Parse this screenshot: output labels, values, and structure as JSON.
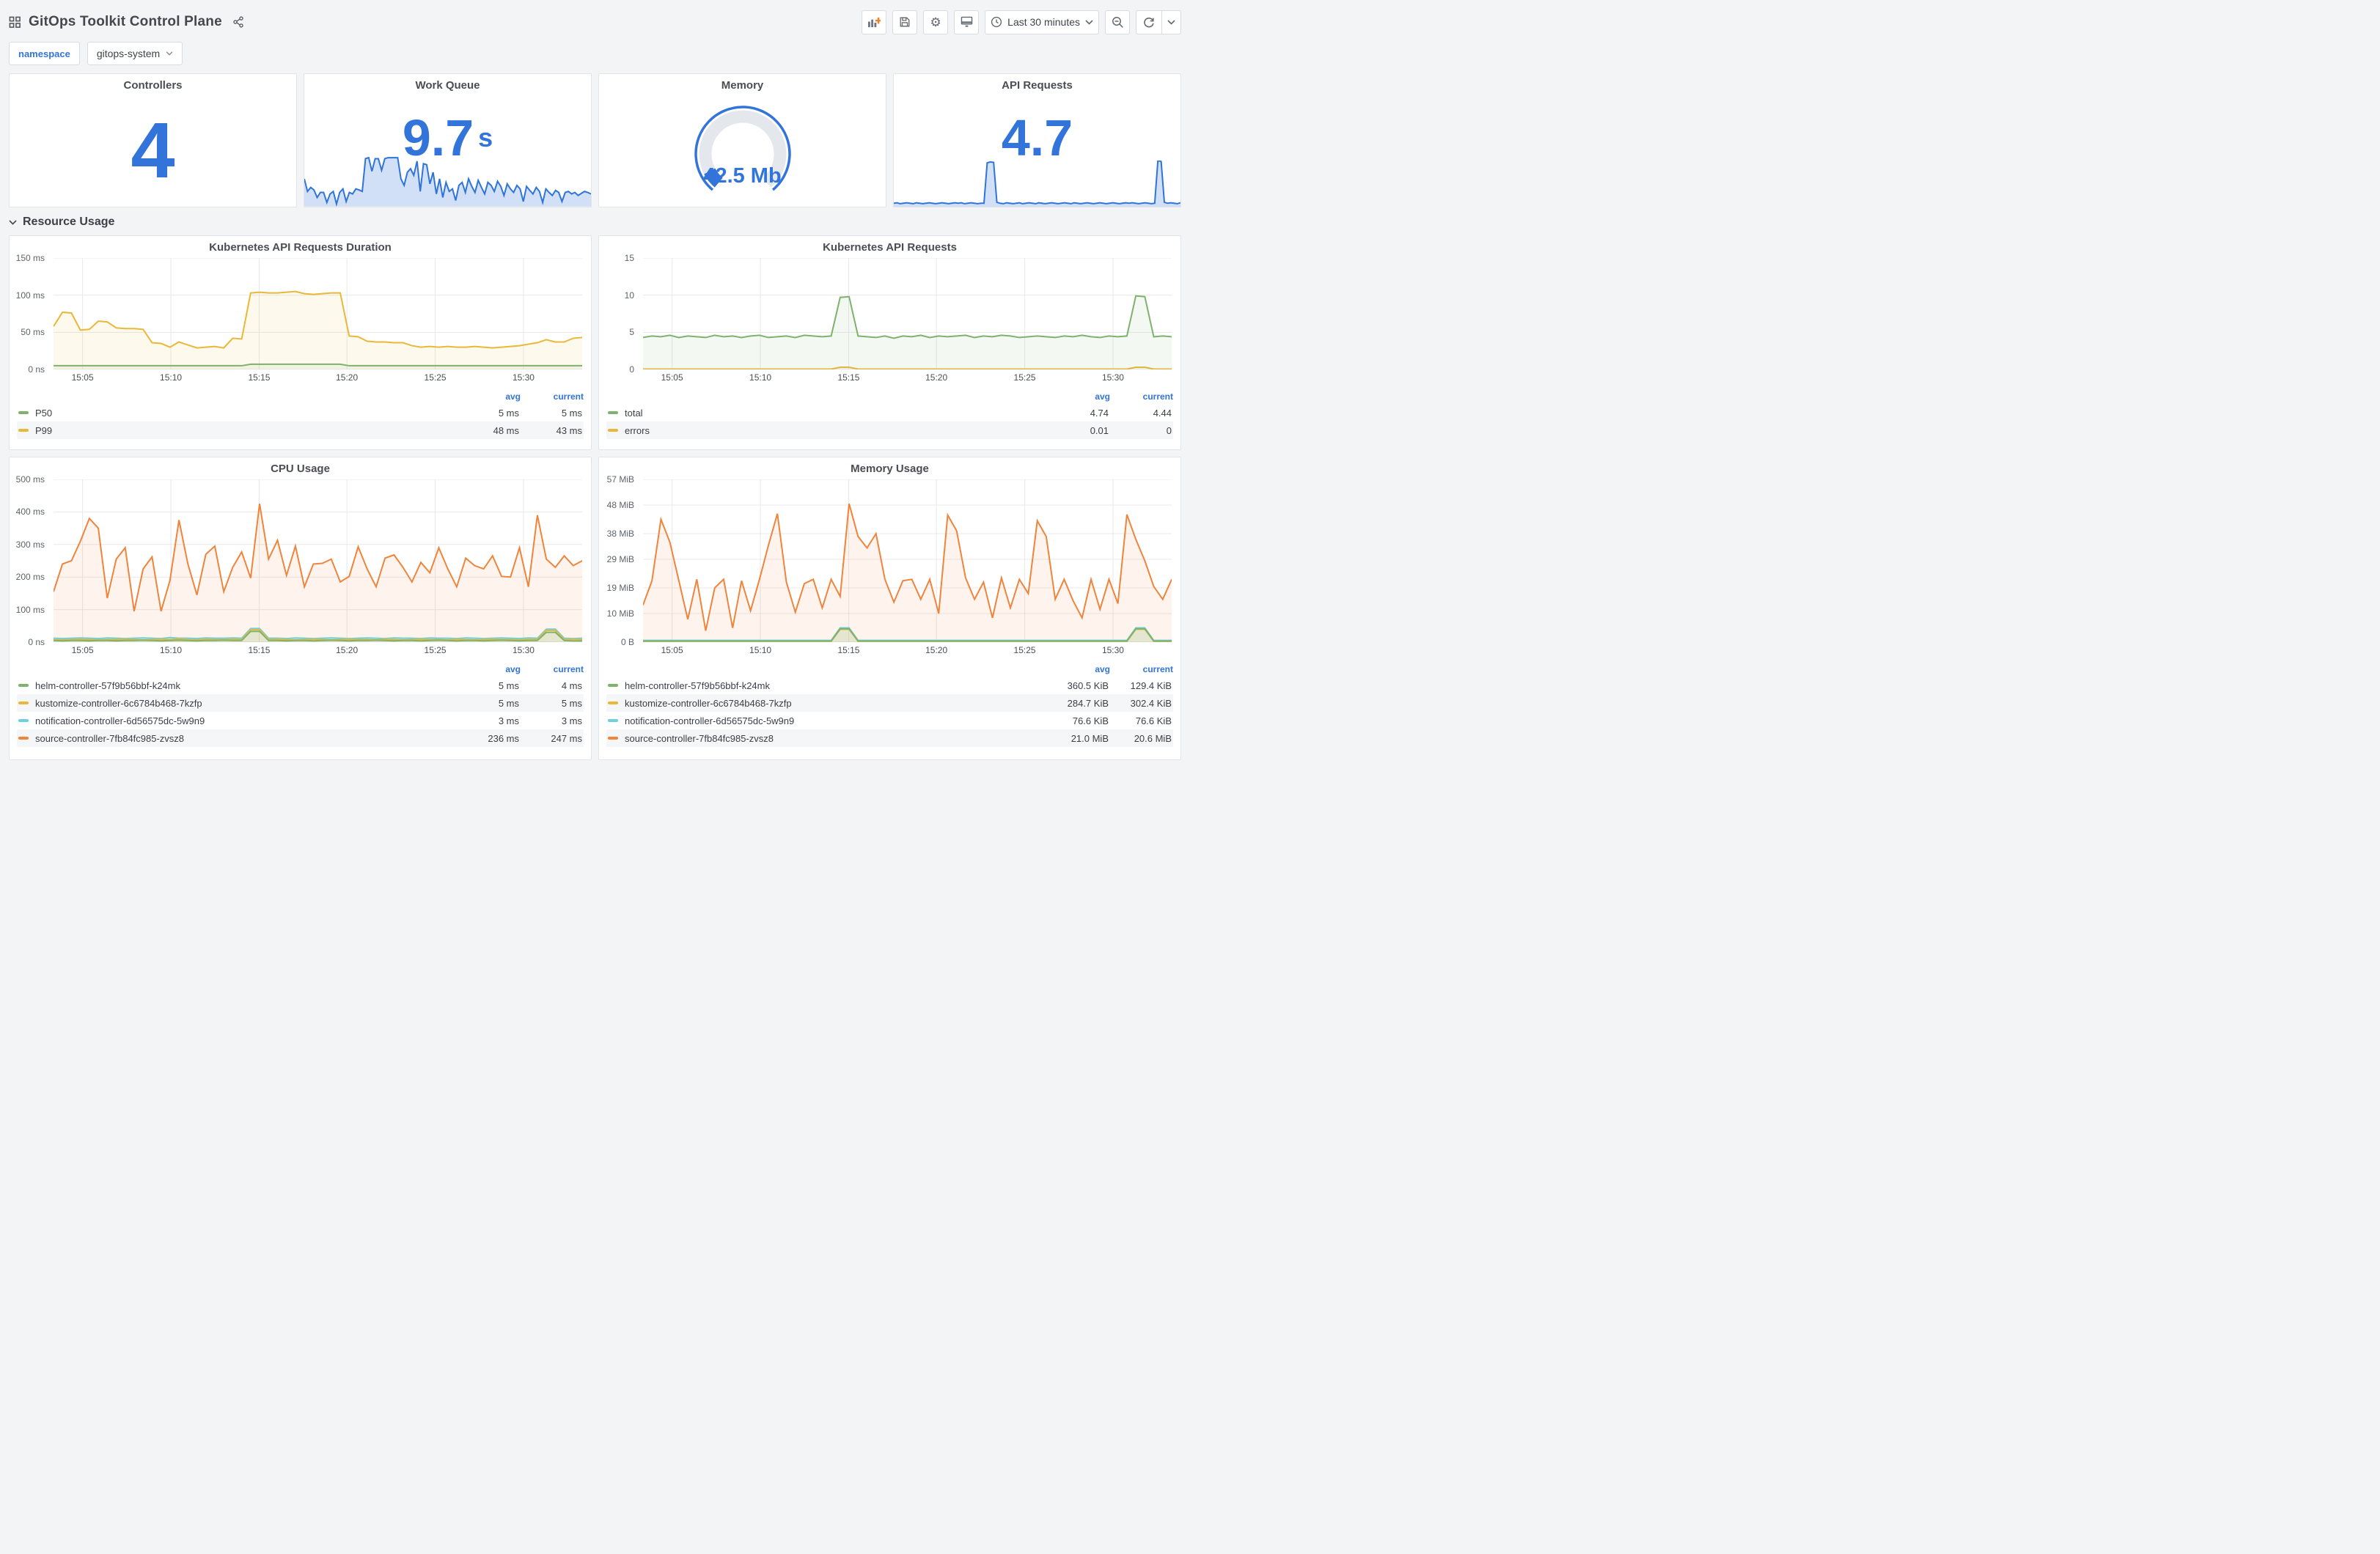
{
  "header": {
    "title": "GitOps Toolkit Control Plane",
    "time_range": "Last 30 minutes"
  },
  "variables": {
    "label": "namespace",
    "value": "gitops-system"
  },
  "row_title": "Resource Usage",
  "legend_headers": [
    "avg",
    "current"
  ],
  "colors": {
    "accent": "#3274D9",
    "green": "#7EB26D",
    "yellow": "#EAB839",
    "lightblue": "#6ED0E0",
    "orange": "#EF843C",
    "spark_line": "#2F74D9",
    "spark_fill": "rgba(50,116,217,0.22)"
  },
  "stats": {
    "controllers": {
      "title": "Controllers",
      "value": "4"
    },
    "work_queue": {
      "title": "Work Queue",
      "value": "9.7",
      "unit": "s",
      "spark": [
        55,
        30,
        38,
        33,
        18,
        28,
        28,
        8,
        25,
        30,
        5,
        28,
        35,
        10,
        28,
        25,
        35,
        33,
        30,
        95,
        97,
        70,
        95,
        95,
        72,
        95,
        97,
        97,
        97,
        97,
        55,
        42,
        68,
        75,
        62,
        90,
        30,
        85,
        83,
        45,
        68,
        25,
        55,
        18,
        48,
        30,
        35,
        12,
        42,
        48,
        28,
        55,
        40,
        28,
        52,
        38,
        25,
        48,
        42,
        30,
        50,
        40,
        22,
        45,
        35,
        28,
        42,
        35,
        10,
        40,
        32,
        25,
        38,
        30,
        8,
        35,
        28,
        22,
        32,
        28,
        10,
        28,
        30,
        25,
        28,
        22,
        26,
        30,
        28,
        25
      ]
    },
    "memory": {
      "title": "Memory",
      "value": "42.5 Mb",
      "fraction": 0.08
    },
    "api_requests": {
      "title": "API Requests",
      "value": "4.7",
      "spark": [
        8,
        9,
        7,
        8,
        9,
        8,
        7,
        9,
        8,
        7,
        8,
        9,
        8,
        7,
        8,
        9,
        8,
        7,
        8,
        9,
        8,
        9,
        7,
        8,
        9,
        8,
        7,
        8,
        8,
        95,
        97,
        96,
        10,
        8,
        7,
        9,
        8,
        7,
        8,
        9,
        7,
        8,
        9,
        8,
        7,
        9,
        8,
        7,
        8,
        9,
        8,
        7,
        8,
        9,
        8,
        7,
        9,
        8,
        7,
        8,
        9,
        8,
        7,
        8,
        9,
        8,
        7,
        8,
        9,
        8,
        7,
        8,
        9,
        8,
        9,
        8,
        7,
        8,
        9,
        8,
        7,
        8,
        100,
        98,
        10,
        8,
        9,
        8,
        7,
        9
      ]
    }
  },
  "x_ticks": [
    {
      "label": "15:05",
      "pos": 0.055
    },
    {
      "label": "15:10",
      "pos": 0.222
    },
    {
      "label": "15:15",
      "pos": 0.389
    },
    {
      "label": "15:20",
      "pos": 0.555
    },
    {
      "label": "15:25",
      "pos": 0.722
    },
    {
      "label": "15:30",
      "pos": 0.889
    }
  ],
  "charts": [
    {
      "title": "Kubernetes API Requests Duration",
      "type": "line",
      "ymax": 150,
      "y_ticks": [
        {
          "v": 0,
          "label": "0 ns"
        },
        {
          "v": 50,
          "label": "50 ms"
        },
        {
          "v": 100,
          "label": "100 ms"
        },
        {
          "v": 150,
          "label": "150 ms"
        }
      ],
      "series": [
        {
          "name": "P50",
          "color": "#7EB26D",
          "avg": "5 ms",
          "current": "5 ms",
          "values": [
            5,
            5,
            5,
            5,
            5,
            5,
            5,
            5,
            5,
            5,
            5,
            5,
            5,
            5,
            5,
            5,
            5,
            5,
            5,
            5,
            5,
            5,
            7,
            7,
            7,
            7,
            7,
            7,
            7,
            7,
            7,
            7,
            7,
            5,
            5,
            5,
            5,
            5,
            5,
            5,
            5,
            5,
            5,
            5,
            5,
            5,
            5,
            5,
            5,
            5,
            5,
            5,
            5,
            5,
            5,
            5,
            5,
            5,
            5,
            5
          ]
        },
        {
          "name": "P99",
          "color": "#EAB839",
          "avg": "48 ms",
          "current": "43 ms",
          "values": [
            58,
            77,
            76,
            53,
            54,
            65,
            64,
            56,
            55,
            55,
            54,
            36,
            35,
            30,
            37,
            33,
            29,
            30,
            31,
            29,
            42,
            41,
            103,
            104,
            103,
            103,
            104,
            105,
            102,
            101,
            102,
            103,
            103,
            45,
            44,
            38,
            37,
            37,
            36,
            36,
            32,
            30,
            31,
            30,
            31,
            30,
            30,
            31,
            30,
            29,
            30,
            31,
            32,
            34,
            36,
            40,
            37,
            37,
            42,
            43
          ]
        }
      ]
    },
    {
      "title": "Kubernetes API Requests",
      "type": "line",
      "ymax": 15,
      "y_ticks": [
        {
          "v": 0,
          "label": "0"
        },
        {
          "v": 5,
          "label": "5"
        },
        {
          "v": 10,
          "label": "10"
        },
        {
          "v": 15,
          "label": "15"
        }
      ],
      "series": [
        {
          "name": "total",
          "color": "#7EB26D",
          "avg": "4.74",
          "current": "4.44",
          "values": [
            4.3,
            4.5,
            4.4,
            4.6,
            4.3,
            4.5,
            4.4,
            4.3,
            4.6,
            4.4,
            4.5,
            4.3,
            4.5,
            4.6,
            4.3,
            4.4,
            4.5,
            4.3,
            4.6,
            4.5,
            4.4,
            4.5,
            9.7,
            9.8,
            4.5,
            4.4,
            4.3,
            4.5,
            4.2,
            4.5,
            4.4,
            4.6,
            4.3,
            4.5,
            4.4,
            4.5,
            4.6,
            4.3,
            4.5,
            4.4,
            4.6,
            4.5,
            4.3,
            4.4,
            4.5,
            4.4,
            4.3,
            4.5,
            4.4,
            4.6,
            4.4,
            4.3,
            4.5,
            4.4,
            4.5,
            9.9,
            9.8,
            4.4,
            4.5,
            4.4
          ]
        },
        {
          "name": "errors",
          "color": "#EAB839",
          "avg": "0.01",
          "current": "0",
          "values": [
            0.05,
            0.05,
            0.05,
            0.05,
            0.05,
            0.05,
            0.05,
            0.05,
            0.05,
            0.05,
            0.05,
            0.05,
            0.05,
            0.05,
            0.05,
            0.05,
            0.05,
            0.05,
            0.05,
            0.05,
            0.05,
            0.05,
            0.3,
            0.3,
            0.05,
            0.05,
            0.05,
            0.05,
            0.05,
            0.05,
            0.05,
            0.05,
            0.05,
            0.05,
            0.05,
            0.05,
            0.05,
            0.05,
            0.05,
            0.05,
            0.05,
            0.05,
            0.05,
            0.05,
            0.05,
            0.05,
            0.05,
            0.05,
            0.05,
            0.05,
            0.05,
            0.05,
            0.05,
            0.05,
            0.05,
            0.3,
            0.3,
            0.05,
            0.05,
            0.05
          ]
        }
      ]
    },
    {
      "title": "CPU Usage",
      "type": "line",
      "ymax": 500,
      "y_ticks": [
        {
          "v": 0,
          "label": "0 ns"
        },
        {
          "v": 100,
          "label": "100 ms"
        },
        {
          "v": 200,
          "label": "200 ms"
        },
        {
          "v": 300,
          "label": "300 ms"
        },
        {
          "v": 400,
          "label": "400 ms"
        },
        {
          "v": 500,
          "label": "500 ms"
        }
      ],
      "series": [
        {
          "name": "helm-controller-57f9b56bbf-k24mk",
          "color": "#7EB26D",
          "avg": "5 ms",
          "current": "4 ms",
          "values": [
            5,
            4,
            5,
            5,
            4,
            5,
            5,
            4,
            5,
            5,
            6,
            5,
            4,
            5,
            6,
            5,
            4,
            5,
            5,
            6,
            5,
            5,
            33,
            33,
            5,
            5,
            4,
            5,
            5,
            4,
            5,
            6,
            5,
            4,
            5,
            5,
            6,
            5,
            4,
            5,
            5,
            4,
            5,
            6,
            5,
            4,
            5,
            5,
            4,
            5,
            6,
            5,
            4,
            5,
            5,
            30,
            30,
            5,
            4,
            4
          ]
        },
        {
          "name": "kustomize-controller-6c6784b468-7kzfp",
          "color": "#EAB839",
          "avg": "5 ms",
          "current": "5 ms",
          "values": [
            8,
            7,
            8,
            9,
            8,
            7,
            8,
            8,
            9,
            8,
            7,
            8,
            9,
            8,
            10,
            8,
            7,
            9,
            8,
            8,
            9,
            8,
            38,
            38,
            8,
            9,
            8,
            7,
            8,
            9,
            8,
            7,
            8,
            9,
            8,
            8,
            7,
            9,
            8,
            7,
            8,
            9,
            8,
            8,
            7,
            9,
            8,
            7,
            8,
            9,
            8,
            8,
            7,
            9,
            8,
            36,
            36,
            8,
            9,
            8
          ]
        },
        {
          "name": "notification-controller-6d56575dc-5w9n9",
          "color": "#6ED0E0",
          "avg": "3 ms",
          "current": "3 ms",
          "values": [
            12,
            11,
            12,
            13,
            12,
            11,
            13,
            12,
            11,
            12,
            13,
            12,
            11,
            14,
            12,
            12,
            11,
            13,
            12,
            12,
            13,
            12,
            42,
            42,
            12,
            12,
            11,
            13,
            12,
            11,
            12,
            13,
            12,
            11,
            12,
            13,
            12,
            11,
            13,
            12,
            12,
            11,
            13,
            12,
            12,
            11,
            13,
            12,
            11,
            12,
            13,
            12,
            11,
            13,
            12,
            40,
            40,
            12,
            11,
            12
          ]
        },
        {
          "name": "source-controller-7fb84fc985-zvsz8",
          "color": "#EF843C",
          "avg": "236 ms",
          "current": "247 ms",
          "values": [
            155,
            240,
            250,
            310,
            380,
            350,
            135,
            255,
            290,
            95,
            225,
            262,
            95,
            190,
            375,
            240,
            145,
            270,
            295,
            155,
            230,
            277,
            197,
            425,
            255,
            313,
            205,
            295,
            170,
            240,
            242,
            255,
            185,
            202,
            293,
            225,
            170,
            258,
            268,
            230,
            185,
            245,
            213,
            290,
            225,
            170,
            258,
            235,
            225,
            265,
            202,
            200,
            290,
            170,
            390,
            255,
            230,
            265,
            235,
            250
          ]
        }
      ]
    },
    {
      "title": "Memory Usage",
      "type": "line",
      "ymax": 57,
      "y_ticks": [
        {
          "v": 0,
          "label": "0 B"
        },
        {
          "v": 10,
          "label": "10 MiB"
        },
        {
          "v": 19,
          "label": "19 MiB"
        },
        {
          "v": 29,
          "label": "29 MiB"
        },
        {
          "v": 38,
          "label": "38 MiB"
        },
        {
          "v": 48,
          "label": "48 MiB"
        },
        {
          "v": 57,
          "label": "57 MiB"
        }
      ],
      "series": [
        {
          "name": "helm-controller-57f9b56bbf-k24mk",
          "color": "#7EB26D",
          "avg": "360.5 KiB",
          "current": "129.4 KiB",
          "values": [
            0.4,
            0.4,
            0.4,
            0.4,
            0.4,
            0.4,
            0.4,
            0.4,
            0.4,
            0.4,
            0.4,
            0.4,
            0.4,
            0.4,
            0.4,
            0.4,
            0.4,
            0.4,
            0.4,
            0.4,
            0.4,
            0.4,
            4.7,
            4.7,
            0.4,
            0.4,
            0.4,
            0.4,
            0.4,
            0.4,
            0.4,
            0.4,
            0.4,
            0.4,
            0.4,
            0.4,
            0.4,
            0.4,
            0.4,
            0.4,
            0.4,
            0.4,
            0.4,
            0.4,
            0.4,
            0.4,
            0.4,
            0.4,
            0.4,
            0.4,
            0.4,
            0.4,
            0.4,
            0.4,
            0.4,
            4.7,
            4.7,
            0.4,
            0.4,
            0.4
          ]
        },
        {
          "name": "kustomize-controller-6c6784b468-7kzfp",
          "color": "#EAB839",
          "avg": "284.7 KiB",
          "current": "302.4 KiB",
          "values": [
            0.3,
            0.3,
            0.3,
            0.3,
            0.3,
            0.3,
            0.3,
            0.3,
            0.3,
            0.3,
            0.3,
            0.3,
            0.3,
            0.3,
            0.3,
            0.3,
            0.3,
            0.3,
            0.3,
            0.3,
            0.3,
            0.3,
            4.5,
            4.5,
            0.3,
            0.3,
            0.3,
            0.3,
            0.3,
            0.3,
            0.3,
            0.3,
            0.3,
            0.3,
            0.3,
            0.3,
            0.3,
            0.3,
            0.3,
            0.3,
            0.3,
            0.3,
            0.3,
            0.3,
            0.3,
            0.3,
            0.3,
            0.3,
            0.3,
            0.3,
            0.3,
            0.3,
            0.3,
            0.3,
            0.3,
            4.5,
            4.5,
            0.3,
            0.3,
            0.3
          ]
        },
        {
          "name": "notification-controller-6d56575dc-5w9n9",
          "color": "#6ED0E0",
          "avg": "76.6 KiB",
          "current": "76.6 KiB",
          "values": [
            0.6,
            0.6,
            0.6,
            0.6,
            0.6,
            0.6,
            0.6,
            0.6,
            0.6,
            0.6,
            0.6,
            0.6,
            0.6,
            0.6,
            0.6,
            0.6,
            0.6,
            0.6,
            0.6,
            0.6,
            0.6,
            0.6,
            5,
            5,
            0.6,
            0.6,
            0.6,
            0.6,
            0.6,
            0.6,
            0.6,
            0.6,
            0.6,
            0.6,
            0.6,
            0.6,
            0.6,
            0.6,
            0.6,
            0.6,
            0.6,
            0.6,
            0.6,
            0.6,
            0.6,
            0.6,
            0.6,
            0.6,
            0.6,
            0.6,
            0.6,
            0.6,
            0.6,
            0.6,
            0.6,
            5,
            5,
            0.6,
            0.6,
            0.6
          ]
        },
        {
          "name": "source-controller-7fb84fc985-zvsz8",
          "color": "#EF843C",
          "avg": "21.0 MiB",
          "current": "20.6 MiB",
          "values": [
            13,
            21.5,
            43,
            35,
            21.5,
            8,
            22,
            4,
            19,
            22,
            5,
            21.5,
            11,
            22,
            34,
            45,
            21,
            10.5,
            20.5,
            22,
            12,
            22,
            16,
            48.5,
            37,
            33,
            38,
            22,
            14,
            21.5,
            22,
            15,
            22,
            10,
            44.5,
            39,
            22.5,
            15,
            21,
            8.5,
            22.5,
            12,
            22,
            17,
            42.5,
            37,
            15,
            22,
            14.5,
            8.5,
            22,
            11.5,
            22,
            13.5,
            44.7,
            36,
            28.5,
            19.5,
            15,
            22
          ]
        }
      ]
    }
  ]
}
